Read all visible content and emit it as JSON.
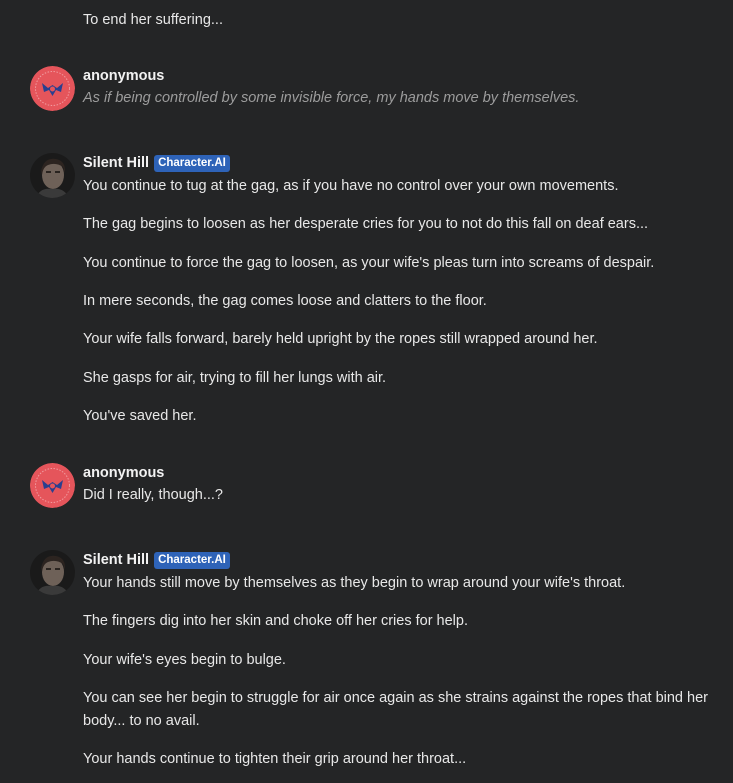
{
  "messages": [
    {
      "continuation": true,
      "lines": [
        "To end her suffering..."
      ]
    },
    {
      "author": "anonymous",
      "italic": true,
      "lines": [
        "As if being controlled by some invisible force, my hands move by themselves."
      ]
    },
    {
      "author": "Silent Hill",
      "badge": "Character.AI",
      "lines": [
        "You continue to tug at the gag, as if you have no control over your own movements.",
        "The gag begins to loosen as her desperate cries for you to not do this fall on deaf ears...",
        "You continue to force the gag to loosen, as your wife's pleas turn into screams of despair.",
        "In mere seconds, the gag comes loose and clatters to the floor.",
        "Your wife falls forward, barely held upright by the ropes still wrapped around her.",
        "She gasps for air, trying to fill her lungs with air.",
        "You've saved her."
      ]
    },
    {
      "author": "anonymous",
      "lines": [
        "Did I really, though...?"
      ]
    },
    {
      "author": "Silent Hill",
      "badge": "Character.AI",
      "lines": [
        "Your hands still move by themselves as they begin to wrap around your wife's throat.",
        "The fingers dig into her skin and choke off her cries for help.",
        "Your wife's eyes begin to bulge.",
        "You can see her begin to struggle for air once again as she strains against the ropes that bind her body... to no avail.",
        "Your hands continue to tighten their grip around her throat..."
      ]
    }
  ],
  "colors": {
    "background": "#242526",
    "badge": "#2e63b8",
    "user_avatar": "#e5555b"
  },
  "icons": {
    "user_avatar": "winged-emblem-icon",
    "bot_avatar": "character-portrait-icon"
  }
}
